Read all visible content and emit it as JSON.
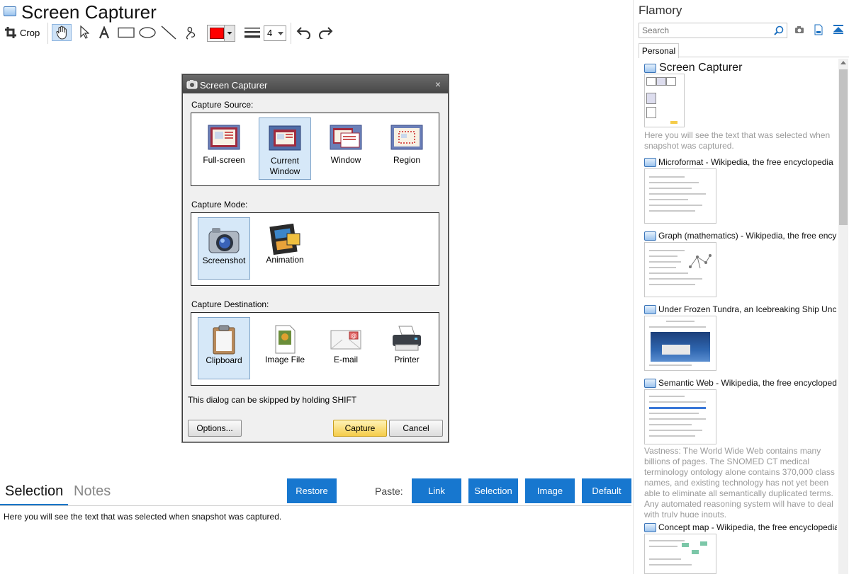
{
  "app": {
    "title": "Screen Capturer",
    "toolbar": {
      "crop_label": "Crop",
      "stroke_width": "4",
      "color": "#ff0000"
    }
  },
  "dialog": {
    "title": "Screen Capturer",
    "close_glyph": "×",
    "source": {
      "label": "Capture Source:",
      "options": [
        {
          "label": "Full-screen",
          "selected": false
        },
        {
          "label": "Current Window",
          "selected": true
        },
        {
          "label": "Window",
          "selected": false
        },
        {
          "label": "Region",
          "selected": false
        }
      ]
    },
    "mode": {
      "label": "Capture Mode:",
      "options": [
        {
          "label": "Screenshot",
          "selected": true
        },
        {
          "label": "Animation",
          "selected": false
        }
      ]
    },
    "destination": {
      "label": "Capture Destination:",
      "options": [
        {
          "label": "Clipboard",
          "selected": true
        },
        {
          "label": "Image File",
          "selected": false
        },
        {
          "label": "E-mail",
          "selected": false
        },
        {
          "label": "Printer",
          "selected": false
        }
      ]
    },
    "hint": "This dialog can be skipped by holding SHIFT",
    "buttons": {
      "options": "Options...",
      "capture": "Capture",
      "cancel": "Cancel"
    }
  },
  "bottom": {
    "tabs": {
      "selection": "Selection",
      "notes": "Notes"
    },
    "restore": "Restore",
    "paste_label": "Paste:",
    "paste_buttons": {
      "link": "Link",
      "selection": "Selection",
      "image": "Image",
      "default": "Default"
    },
    "selection_text": "Here you will see the text that was selected when snapshot was captured."
  },
  "flamory": {
    "title": "Flamory",
    "search_placeholder": "Search",
    "tab": "Personal",
    "header_item": {
      "title": "Screen Capturer",
      "desc": "Here you will see the text that was selected when snapshot was captured."
    },
    "items": [
      {
        "title": "Microformat - Wikipedia, the free encyclopedia"
      },
      {
        "title": "Graph (mathematics) - Wikipedia, the free ency"
      },
      {
        "title": "Under Frozen Tundra, an Icebreaking Ship Unco"
      },
      {
        "title": "Semantic Web - Wikipedia, the free encycloped",
        "desc": "Vastness: The World Wide Web contains many billions of pages. The SNOMED CT medical terminology ontology alone contains 370,000 class names, and existing technology has not yet been able to eliminate all semantically duplicated terms. Any automated reasoning system will have to deal with truly huge inputs."
      },
      {
        "title": "Concept map - Wikipedia, the free encyclopedia"
      }
    ]
  }
}
